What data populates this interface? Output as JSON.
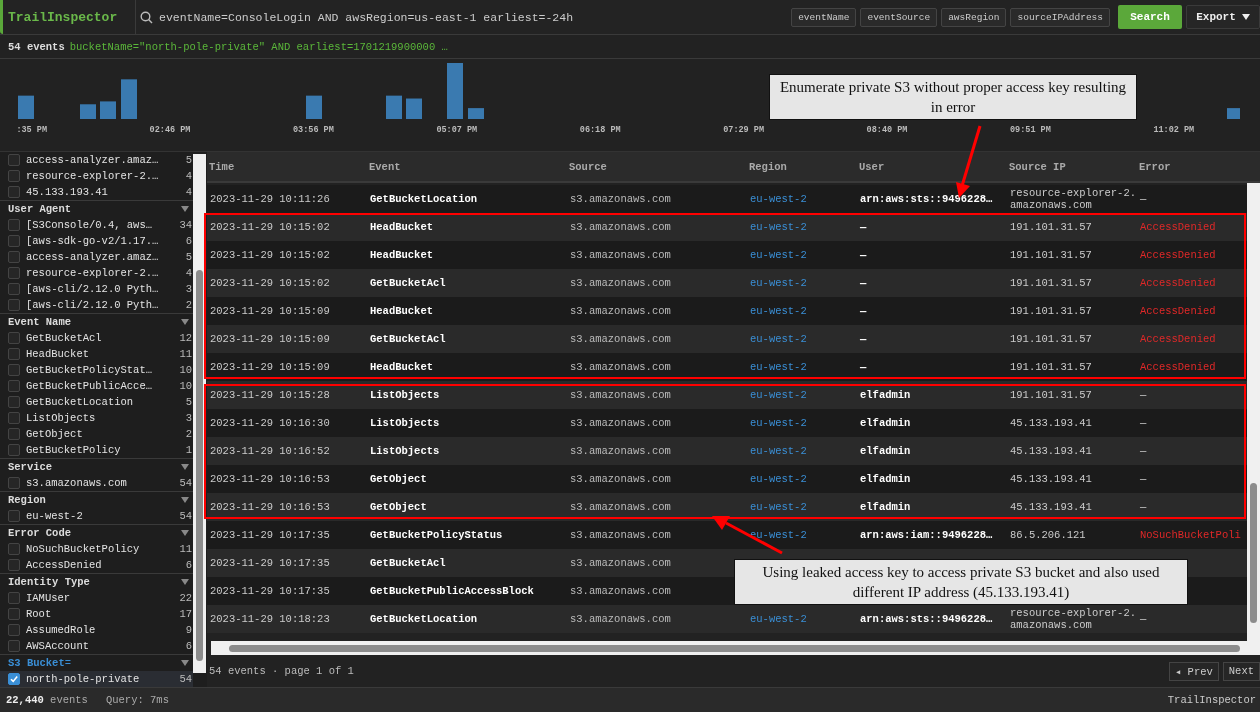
{
  "app": {
    "name": "TrailInspector"
  },
  "search": {
    "query": "eventName=ConsoleLogin AND awsRegion=us-east-1 earliest=-24h"
  },
  "field_chips": [
    "eventName",
    "eventSource",
    "awsRegion",
    "sourceIPAddress"
  ],
  "buttons": [
    {
      "label": "Search",
      "kind": "primary"
    },
    {
      "label": "Export",
      "kind": "menu"
    }
  ],
  "summary": {
    "count": "54 events",
    "query": "bucketName=\"north-pole-private\" AND earliest=1701219900000 …"
  },
  "histogram": {
    "time_labels": [
      ":35 PM",
      "02:46 PM",
      "03:56 PM",
      "05:07 PM",
      "06:18 PM",
      "07:29 PM",
      "08:40 PM",
      "09:51 PM",
      "11:02 PM"
    ]
  },
  "sidebar": {
    "groups": [
      {
        "items": [
          {
            "label": "access-analyzer.amaz…",
            "count": "5",
            "checked": false
          },
          {
            "label": "resource-explorer-2.…",
            "count": "4",
            "checked": false
          },
          {
            "label": "45.133.193.41",
            "count": "4",
            "checked": false
          }
        ]
      },
      {
        "title": "User Agent",
        "active": false,
        "items": [
          {
            "label": "[S3Console/0.4, aws…",
            "count": "34",
            "checked": false
          },
          {
            "label": "[aws-sdk-go-v2/1.17.…",
            "count": "6",
            "checked": false
          },
          {
            "label": "access-analyzer.amaz…",
            "count": "5",
            "checked": false
          },
          {
            "label": "resource-explorer-2.…",
            "count": "4",
            "checked": false
          },
          {
            "label": "[aws-cli/2.12.0 Pyth…",
            "count": "3",
            "checked": false
          },
          {
            "label": "[aws-cli/2.12.0 Pyth…",
            "count": "2",
            "checked": false
          }
        ]
      },
      {
        "title": "Event Name",
        "active": false,
        "items": [
          {
            "label": "GetBucketAcl",
            "count": "12",
            "checked": false
          },
          {
            "label": "HeadBucket",
            "count": "11",
            "checked": false
          },
          {
            "label": "GetBucketPolicyStat…",
            "count": "10",
            "checked": false
          },
          {
            "label": "GetBucketPublicAcce…",
            "count": "10",
            "checked": false
          },
          {
            "label": "GetBucketLocation",
            "count": "5",
            "checked": false
          },
          {
            "label": "ListObjects",
            "count": "3",
            "checked": false
          },
          {
            "label": "GetObject",
            "count": "2",
            "checked": false
          },
          {
            "label": "GetBucketPolicy",
            "count": "1",
            "checked": false
          }
        ]
      },
      {
        "title": "Service",
        "active": false,
        "items": [
          {
            "label": "s3.amazonaws.com",
            "count": "54",
            "checked": false
          }
        ]
      },
      {
        "title": "Region",
        "active": false,
        "items": [
          {
            "label": "eu-west-2",
            "count": "54",
            "checked": false
          }
        ]
      },
      {
        "title": "Error Code",
        "active": false,
        "items": [
          {
            "label": "NoSuchBucketPolicy",
            "count": "11",
            "checked": false
          },
          {
            "label": "AccessDenied",
            "count": "6",
            "checked": false
          }
        ]
      },
      {
        "title": "Identity Type",
        "active": false,
        "items": [
          {
            "label": "IAMUser",
            "count": "22",
            "checked": false
          },
          {
            "label": "Root",
            "count": "17",
            "checked": false
          },
          {
            "label": "AssumedRole",
            "count": "9",
            "checked": false
          },
          {
            "label": "AWSAccount",
            "count": "6",
            "checked": false
          }
        ]
      },
      {
        "title": "S3 Bucket",
        "operator": "=",
        "active": true,
        "items": [
          {
            "label": "north-pole-private",
            "count": "54",
            "checked": true
          }
        ]
      }
    ]
  },
  "table": {
    "columns": [
      "Time",
      "Event",
      "Source",
      "Region",
      "User",
      "Source IP",
      "Error"
    ],
    "rows": [
      {
        "time": "2023-11-29 10:11:26",
        "event": "GetBucketLocation",
        "source": "s3.amazonaws.com",
        "region": "eu-west-2",
        "user": "arn:aws:sts::9496228…",
        "source_ip": "resource-explorer-2.amazonaws.com",
        "error": "—",
        "failed": false
      },
      {
        "time": "2023-11-29 10:15:02",
        "event": "HeadBucket",
        "source": "s3.amazonaws.com",
        "region": "eu-west-2",
        "user": "—",
        "source_ip": "191.101.31.57",
        "error": "AccessDenied",
        "failed": true
      },
      {
        "time": "2023-11-29 10:15:02",
        "event": "HeadBucket",
        "source": "s3.amazonaws.com",
        "region": "eu-west-2",
        "user": "—",
        "source_ip": "191.101.31.57",
        "error": "AccessDenied",
        "failed": true
      },
      {
        "time": "2023-11-29 10:15:02",
        "event": "GetBucketAcl",
        "source": "s3.amazonaws.com",
        "region": "eu-west-2",
        "user": "—",
        "source_ip": "191.101.31.57",
        "error": "AccessDenied",
        "failed": true
      },
      {
        "time": "2023-11-29 10:15:09",
        "event": "HeadBucket",
        "source": "s3.amazonaws.com",
        "region": "eu-west-2",
        "user": "—",
        "source_ip": "191.101.31.57",
        "error": "AccessDenied",
        "failed": true
      },
      {
        "time": "2023-11-29 10:15:09",
        "event": "GetBucketAcl",
        "source": "s3.amazonaws.com",
        "region": "eu-west-2",
        "user": "—",
        "source_ip": "191.101.31.57",
        "error": "AccessDenied",
        "failed": true
      },
      {
        "time": "2023-11-29 10:15:09",
        "event": "HeadBucket",
        "source": "s3.amazonaws.com",
        "region": "eu-west-2",
        "user": "—",
        "source_ip": "191.101.31.57",
        "error": "AccessDenied",
        "failed": true
      },
      {
        "time": "2023-11-29 10:15:28",
        "event": "ListObjects",
        "source": "s3.amazonaws.com",
        "region": "eu-west-2",
        "user": "elfadmin",
        "source_ip": "191.101.31.57",
        "error": "—",
        "failed": false
      },
      {
        "time": "2023-11-29 10:16:30",
        "event": "ListObjects",
        "source": "s3.amazonaws.com",
        "region": "eu-west-2",
        "user": "elfadmin",
        "source_ip": "45.133.193.41",
        "error": "—",
        "failed": false
      },
      {
        "time": "2023-11-29 10:16:52",
        "event": "ListObjects",
        "source": "s3.amazonaws.com",
        "region": "eu-west-2",
        "user": "elfadmin",
        "source_ip": "45.133.193.41",
        "error": "—",
        "failed": false
      },
      {
        "time": "2023-11-29 10:16:53",
        "event": "GetObject",
        "source": "s3.amazonaws.com",
        "region": "eu-west-2",
        "user": "elfadmin",
        "source_ip": "45.133.193.41",
        "error": "—",
        "failed": false
      },
      {
        "time": "2023-11-29 10:16:53",
        "event": "GetObject",
        "source": "s3.amazonaws.com",
        "region": "eu-west-2",
        "user": "elfadmin",
        "source_ip": "45.133.193.41",
        "error": "—",
        "failed": false
      },
      {
        "time": "2023-11-29 10:17:35",
        "event": "GetBucketPolicyStatus",
        "source": "s3.amazonaws.com",
        "region": "eu-west-2",
        "user": "arn:aws:iam::9496228…",
        "source_ip": "86.5.206.121",
        "error": "NoSuchBucketPoli",
        "failed": true
      },
      {
        "time": "2023-11-29 10:17:35",
        "event": "GetBucketAcl",
        "source": "s3.amazonaws.com"
      },
      {
        "time": "2023-11-29 10:17:35",
        "event": "GetBucketPublicAccessBlock",
        "source": "s3.amazonaws.com"
      },
      {
        "time": "2023-11-29 10:18:23",
        "event": "GetBucketLocation",
        "source": "s3.amazonaws.com",
        "region": "eu-west-2",
        "user": "arn:aws:sts::9496228…",
        "source_ip": "resource-explorer-2.amazonaws.com",
        "error": "—",
        "failed": false
      }
    ]
  },
  "pager": {
    "summary": "54 events · page 1 of 1",
    "buttons": [
      "◂ Prev",
      "Next"
    ]
  },
  "status_bar": {
    "events_count": "22,440",
    "events_label": "events",
    "query_time": "Query: 7ms",
    "app_name": "TrailInspector"
  },
  "annotations": [
    {
      "text": "Enumerate private S3 without proper access key resulting in error"
    },
    {
      "text": "Using leaked access key to access private S3 bucket and also used different IP address (45.133.193.41)"
    }
  ]
}
